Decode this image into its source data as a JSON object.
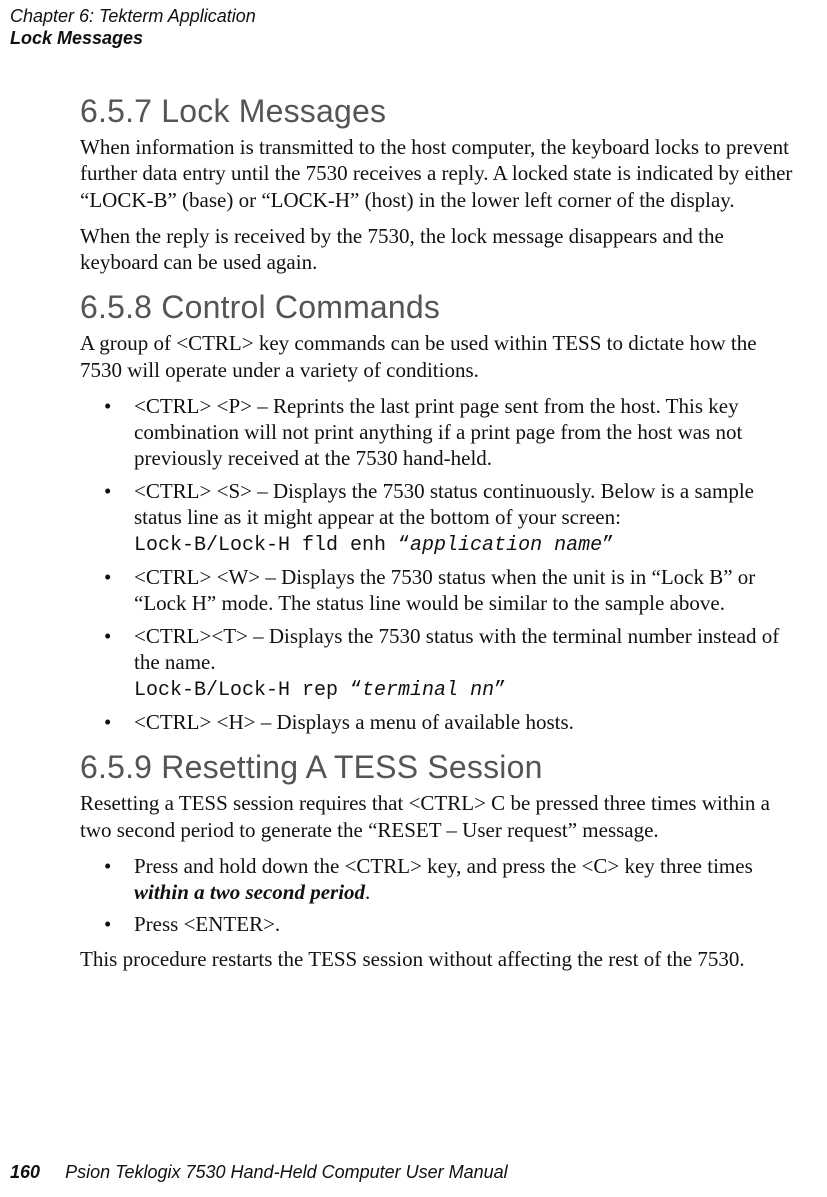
{
  "header": {
    "chapter": "Chapter 6: Tekterm Application",
    "subtitle": "Lock Messages"
  },
  "sections": {
    "s657": {
      "heading": "6.5.7  Lock Messages",
      "p1": "When information is transmitted to the host computer, the keyboard locks to prevent further data entry until the 7530 receives a reply. A locked state is indicated by either “LOCK-B” (base) or “LOCK-H” (host) in the lower left corner of the display.",
      "p2": "When the reply is received by the 7530, the lock message disappears and the keyboard can be used again."
    },
    "s658": {
      "heading": "6.5.8  Control Commands",
      "p1": "A group of <CTRL> key commands can be used within TESS to dictate how the 7530 will operate under a variety of conditions.",
      "b1": " <CTRL> <P>  – Reprints the last print page sent from the host. This key combination will not print anything if a print page from the host was not previously received at the 7530 hand-held.",
      "b2_text": "<CTRL> <S> – Displays the 7530 status continuously. Below is a sample status line as it might appear at the bottom of your screen:",
      "b2_code_prefix": "Lock-B/Lock-H    fld   enh   “",
      "b2_code_italic": "application name",
      "b2_code_suffix": "”",
      "b3": "<CTRL> <W> – Displays the 7530 status when the unit is in “Lock B” or “Lock H” mode. The status line would be similar to the sample above.",
      "b4_text": "<CTRL><T> – Displays the 7530 status with the terminal number instead of the name.",
      "b4_code_prefix": "Lock-B/Lock-H    rep          “",
      "b4_code_italic": "terminal nn",
      "b4_code_suffix": "”",
      "b5": "<CTRL> <H> – Displays a menu of available hosts."
    },
    "s659": {
      "heading": "6.5.9  Resetting A TESS Session",
      "p1": "Resetting a TESS session requires that <CTRL> C be pressed three times within a two second period to generate the “RESET – User request” message.",
      "b1_pre": "Press and hold down the <CTRL> key, and press the <C> key three times ",
      "b1_bold": "within a two second period",
      "b1_post": ".",
      "b2": "Press <ENTER>.",
      "p2": "This procedure restarts the TESS session without affecting the rest of the 7530."
    }
  },
  "footer": {
    "page": "160",
    "book": "Psion Teklogix 7530 Hand-Held Computer User Manual"
  }
}
